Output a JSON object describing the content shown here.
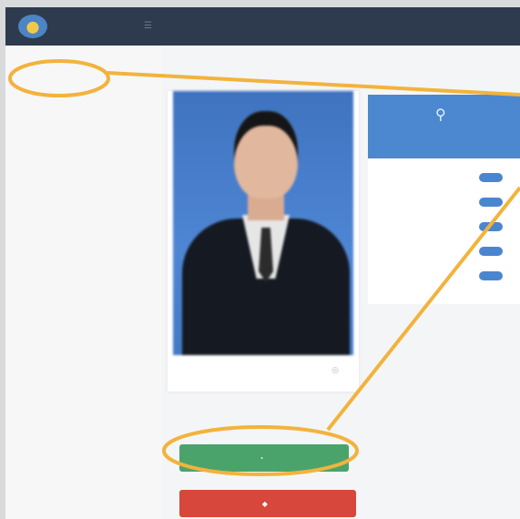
{
  "header": {
    "brand_lines": "",
    "menu_icon": "menu-icon"
  },
  "sidebar": {
    "items": [
      {
        "label": ""
      },
      {
        "label": ""
      },
      {
        "label": ""
      },
      {
        "label": ""
      },
      {
        "label": ""
      }
    ]
  },
  "main": {
    "title": ""
  },
  "photo_card": {
    "edit_icon": "camera-icon"
  },
  "right_panel": {
    "title": "",
    "icon": "badge-icon",
    "rows": [
      {
        "year": "",
        "badge": ""
      },
      {
        "year": "",
        "badge": ""
      },
      {
        "year": "",
        "badge": ""
      },
      {
        "year": "",
        "badge": ""
      },
      {
        "year": "",
        "badge": ""
      }
    ]
  },
  "footnote": "",
  "buttons": {
    "green_label": "",
    "red_label": ""
  },
  "bottom_words": [
    "",
    ""
  ],
  "colors": {
    "topbar": "#2e3a4d",
    "panel_blue": "#4b88d0",
    "green_button": "#4ba36c",
    "red_button": "#d7473c",
    "highlight": "#f2b33d"
  }
}
